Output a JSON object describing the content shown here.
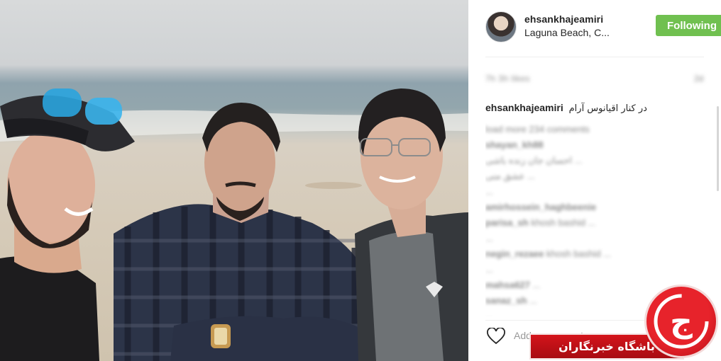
{
  "post": {
    "username": "ehsankhajeamiri",
    "location": "Laguna Beach, C...",
    "follow_label": "Following",
    "timestamp_blurred": "7h 3h likes",
    "timestamp_right_blurred": "2d",
    "caption_user": "ehsankhajeamiri",
    "caption_text": "در کنار اقیانوس آرام",
    "comments": [
      {
        "user": "",
        "text": "load more 234 comments"
      },
      {
        "user": "shayan_kh88",
        "text": ""
      },
      {
        "user": "",
        "text": "احسان جان زنده باشی ..."
      },
      {
        "user": "",
        "text": "عشق منی ..."
      },
      {
        "user": "",
        "text": "..."
      },
      {
        "user": "amirhossein_haghbeenie",
        "text": ""
      },
      {
        "user": "parisa_sh",
        "text": "khosh bashid ..."
      },
      {
        "user": "",
        "text": "..."
      },
      {
        "user": "",
        "text": ""
      },
      {
        "user": "negin_rezaee",
        "text": "khosh bashid ..."
      },
      {
        "user": "",
        "text": "..."
      },
      {
        "user": "mahsa627",
        "text": "..."
      },
      {
        "user": "",
        "text": ""
      },
      {
        "user": "sanaz_sh",
        "text": "..."
      },
      {
        "user": "",
        "text": ""
      },
      {
        "user": "",
        "text": "..."
      }
    ],
    "add_comment_placeholder": "Add a comment..."
  },
  "watermark": {
    "banner_text": "باشگاه خبرنگاران",
    "logo_glyph": "ج"
  },
  "icons": {
    "like": "heart-icon",
    "avatar": "avatar"
  },
  "colors": {
    "follow_button": "#70c050",
    "watermark_red": "#d4141b"
  }
}
